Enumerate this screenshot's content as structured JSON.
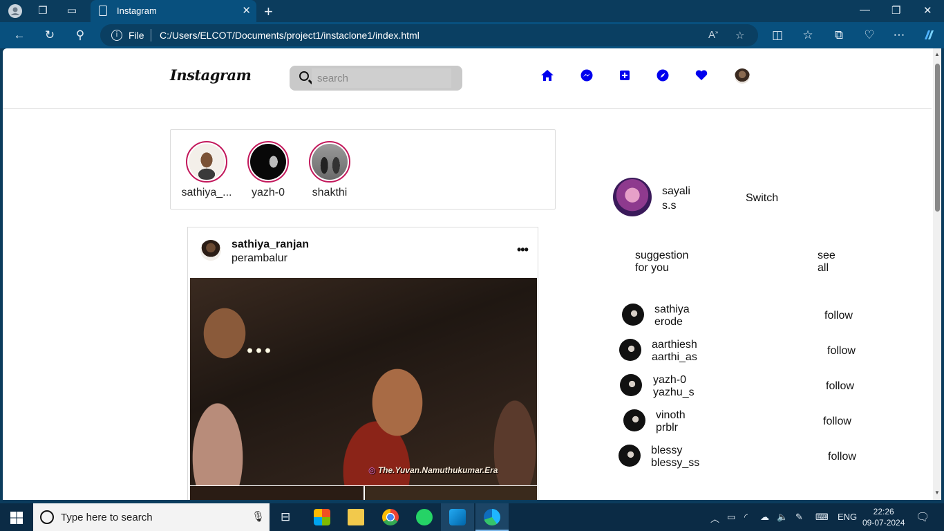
{
  "browser": {
    "tab_title": "Instagram",
    "address_scheme": "File",
    "url": "C:/Users/ELCOT/Documents/project1/instaclone1/index.html"
  },
  "header": {
    "logo_text": "Instagram",
    "search_placeholder": "search"
  },
  "stories": [
    {
      "name": "sathiya_..."
    },
    {
      "name": "yazh-0"
    },
    {
      "name": "shakthi"
    }
  ],
  "post": {
    "username": "sathiya_ranjan",
    "location": "perambalur",
    "more_label": "•••",
    "watermark": "The.Yuvan.Namuthukumar.Era"
  },
  "profile": {
    "name_line1": "sayali",
    "name_line2": "s.s",
    "switch_label": "Switch"
  },
  "suggestions": {
    "heading_line1": "suggestion",
    "heading_line2": "for you",
    "see_all_line1": "see",
    "see_all_line2": "all",
    "items": [
      {
        "name": "sathiya",
        "sub": "erode",
        "action": "follow"
      },
      {
        "name": "aarthiesh",
        "sub": "aarthi_as",
        "action": "follow"
      },
      {
        "name": "yazh-0",
        "sub": "yazhu_s",
        "action": "follow"
      },
      {
        "name": "vinoth",
        "sub": "prblr",
        "action": "follow"
      },
      {
        "name": "blessy",
        "sub": "blessy_ss",
        "action": "follow"
      }
    ]
  },
  "taskbar": {
    "search_placeholder": "Type here to search",
    "lang": "ENG",
    "time": "22:26",
    "date": "09-07-2024"
  },
  "colors": {
    "browser_frame": "#0b3c5d",
    "nav_icon_blue": "#0000ee",
    "story_ring": "#c2185b"
  }
}
